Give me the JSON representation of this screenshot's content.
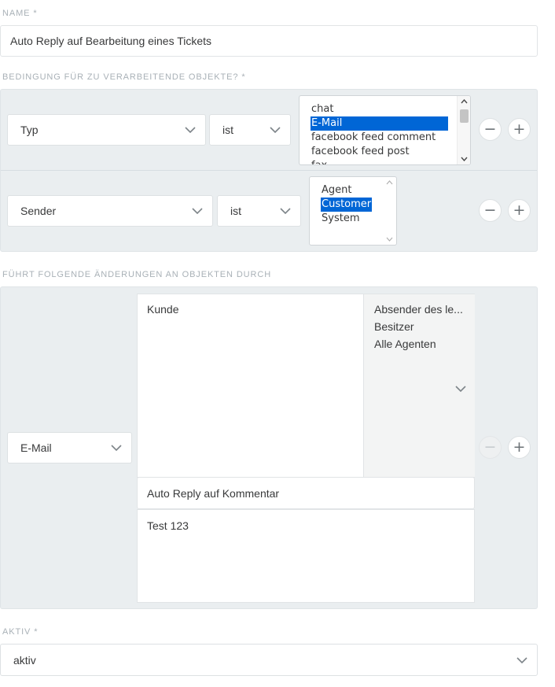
{
  "name_field": {
    "label": "NAME *",
    "value": "Auto Reply auf Bearbeitung eines Tickets"
  },
  "conditions": {
    "label": "BEDINGUNG FÜR ZU VERARBEITENDE OBJEKTE? *",
    "rows": [
      {
        "attribute": "Typ",
        "operator": "ist",
        "options": [
          "chat",
          "E-Mail",
          "facebook feed comment",
          "facebook feed post",
          "fax"
        ],
        "selected": "E-Mail",
        "remove": "−",
        "add": "+"
      },
      {
        "attribute": "Sender",
        "operator": "ist",
        "options": [
          "Agent",
          "Customer",
          "System"
        ],
        "selected": "Customer",
        "remove": "−",
        "add": "+"
      }
    ]
  },
  "actions": {
    "label": "FÜHRT FOLGENDE ÄNDERUNGEN AN OBJEKTEN DURCH",
    "action_type": "E-Mail",
    "recipient_selected": "Kunde",
    "recipient_options": [
      "Absender des le...",
      "Besitzer",
      "Alle Agenten"
    ],
    "subject": "Auto Reply auf Kommentar",
    "body": "Test 123",
    "remove": "−",
    "add": "+"
  },
  "active_field": {
    "label": "AKTIV *",
    "value": "aktiv"
  },
  "colors": {
    "panel_bg": "#eaeef0",
    "selection": "#0066d6",
    "label": "#a9b1b7"
  },
  "icons": [
    "chevron-down-icon",
    "minus-icon",
    "plus-icon",
    "scroll-up-icon",
    "scroll-down-icon"
  ]
}
